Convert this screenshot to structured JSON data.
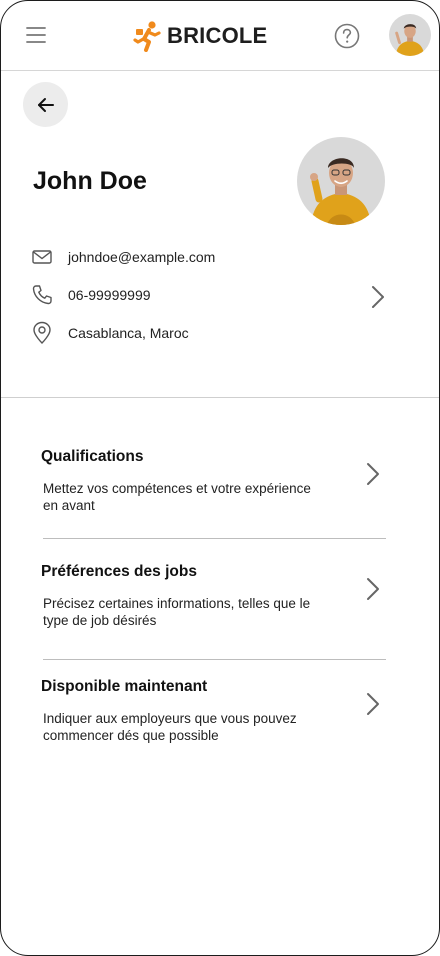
{
  "header": {
    "brand": "BRICOLE",
    "icons": {
      "menu": "menu-icon",
      "help": "help-icon",
      "avatar": "user-avatar"
    },
    "brand_color": "#f08a1c"
  },
  "profile": {
    "name": "John Doe",
    "email": "johndoe@example.com",
    "phone": "06-99999999",
    "location": "Casablanca, Maroc"
  },
  "sections": [
    {
      "title": "Qualifications",
      "description": "Mettez vos compétences et votre expérience en avant"
    },
    {
      "title": "Préférences des jobs",
      "description": "Précisez certaines informations, telles que le type de job désirés"
    },
    {
      "title": "Disponible maintenant",
      "description": "Indiquer aux employeurs que vous pouvez commencer dés que possible"
    }
  ],
  "colors": {
    "accent": "#f08a1c",
    "shirt": "#e0a21b",
    "back_button_bg": "#ececec"
  }
}
